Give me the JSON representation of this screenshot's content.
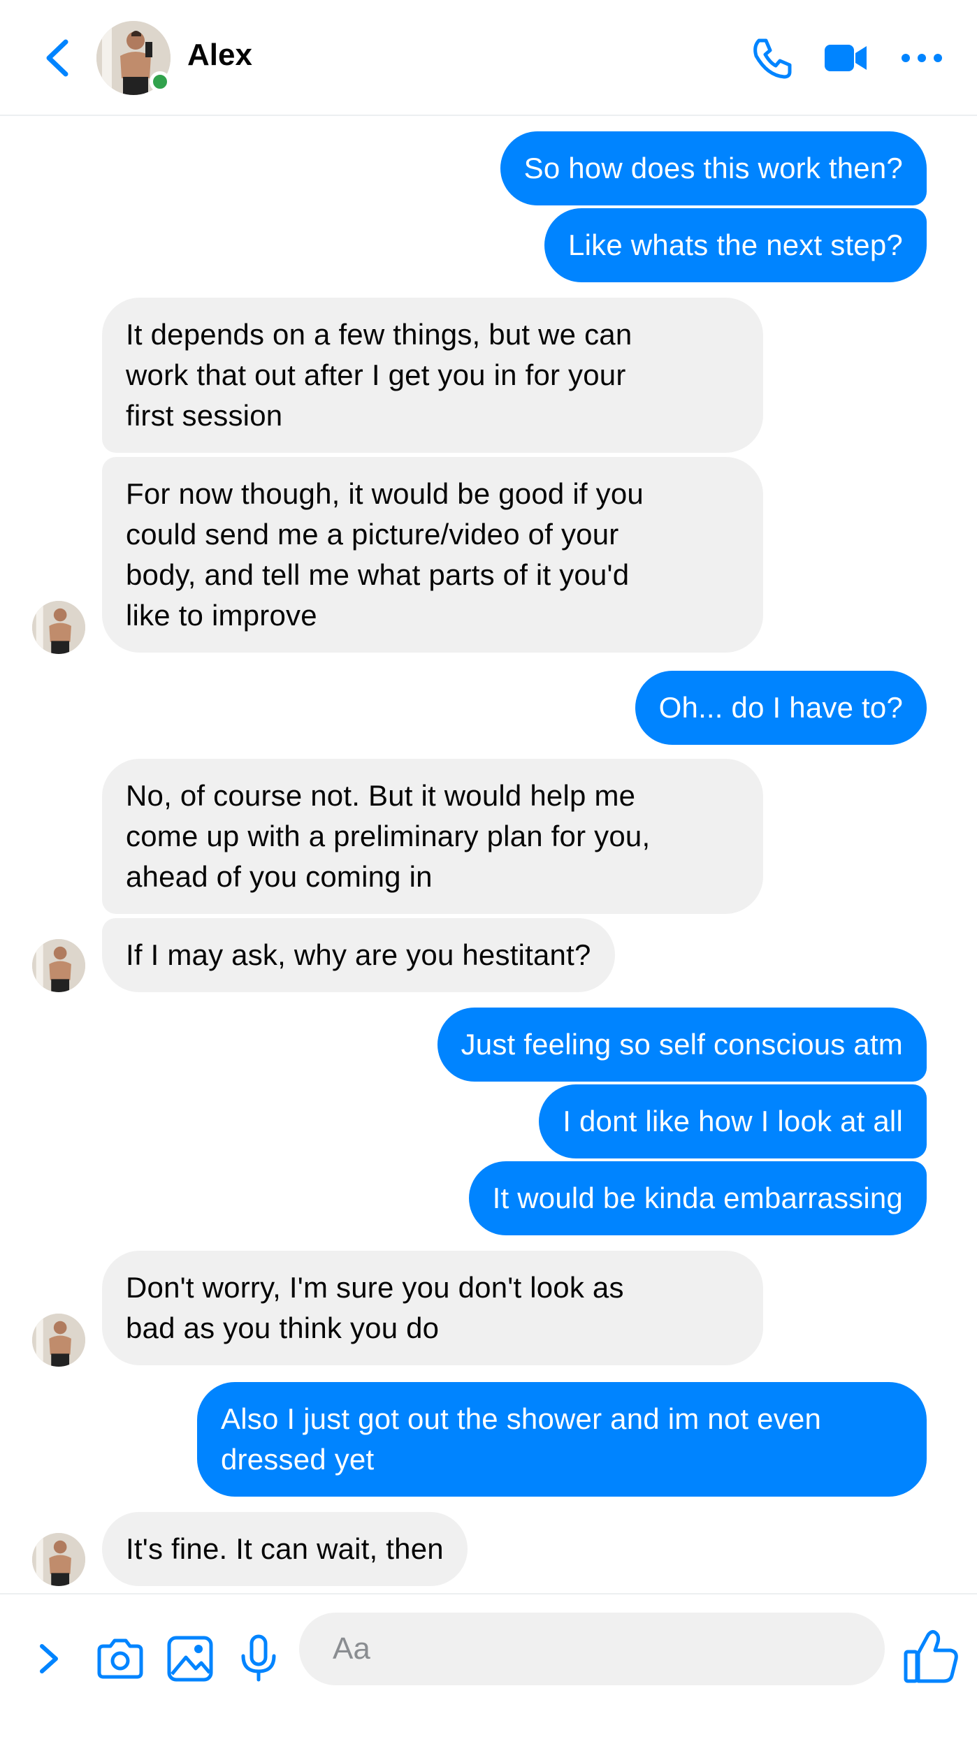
{
  "header": {
    "contact_name": "Alex",
    "back_icon": "chevron-left-icon",
    "call_icon": "phone-icon",
    "video_icon": "video-camera-icon",
    "more_icon": "more-horizontal-icon",
    "online_status_color": "#31a24c"
  },
  "colors": {
    "accent": "#0084ff",
    "incoming_bubble": "#f0f0f0",
    "text": "#050505"
  },
  "messages": [
    {
      "from": "me",
      "text": "So how does this work then?"
    },
    {
      "from": "me",
      "text": "Like whats the next step?"
    },
    {
      "from": "Alex",
      "lines": [
        "It depends on a few things, but we can",
        "work that out after I get you in for your",
        "first session"
      ]
    },
    {
      "from": "Alex",
      "lines": [
        "For now though, it would be good if you",
        "could send me a picture/video of your",
        "body, and tell me what parts of it you'd",
        "like to improve"
      ]
    },
    {
      "from": "me",
      "text": "Oh... do I have to?"
    },
    {
      "from": "Alex",
      "lines": [
        "No, of course not. But it would help me",
        "come up with a preliminary plan for you,",
        "ahead of you coming in"
      ]
    },
    {
      "from": "Alex",
      "text": "If I may ask, why are you hestitant?"
    },
    {
      "from": "me",
      "text": "Just feeling so self conscious atm"
    },
    {
      "from": "me",
      "text": "I dont like how I look at all"
    },
    {
      "from": "me",
      "text": "It would be kinda embarrassing"
    },
    {
      "from": "Alex",
      "lines": [
        "Don't worry, I'm sure you don't look as",
        "bad as you think you do"
      ]
    },
    {
      "from": "me",
      "lines": [
        "Also I just got out the shower and im not even",
        "dressed yet"
      ]
    },
    {
      "from": "Alex",
      "text": "It's fine. It can wait, then"
    }
  ],
  "composer": {
    "placeholder": "Aa",
    "expand_icon": "chevron-right-icon",
    "camera_icon": "camera-icon",
    "gallery_icon": "image-icon",
    "mic_icon": "microphone-icon",
    "like_icon": "thumbs-up-icon"
  }
}
